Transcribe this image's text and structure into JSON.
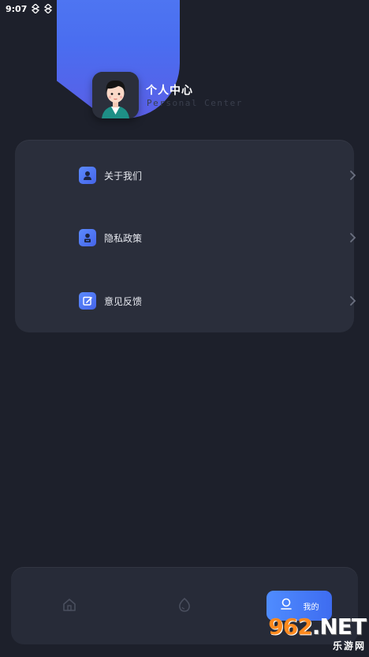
{
  "status_bar": {
    "time": "9:07"
  },
  "profile": {
    "title": "个人中心",
    "subtitle": "Personal Center"
  },
  "menu": {
    "items": [
      {
        "label": "关于我们",
        "icon": "person-card-icon"
      },
      {
        "label": "隐私政策",
        "icon": "user-badge-icon"
      },
      {
        "label": "意见反馈",
        "icon": "edit-note-icon"
      }
    ]
  },
  "tab_bar": {
    "home_icon": "home-icon",
    "discover_icon": "egg-icon",
    "mine_label": "我的",
    "mine_icon": "user-icon"
  },
  "watermark": {
    "brand_num": "962",
    "brand_net": ".NET",
    "brand_cn": "乐游网"
  },
  "colors": {
    "background": "#1d202b",
    "card": "#2a2e3b",
    "accent": "#4f78f2",
    "watermark_orange": "#ff8a1f"
  }
}
